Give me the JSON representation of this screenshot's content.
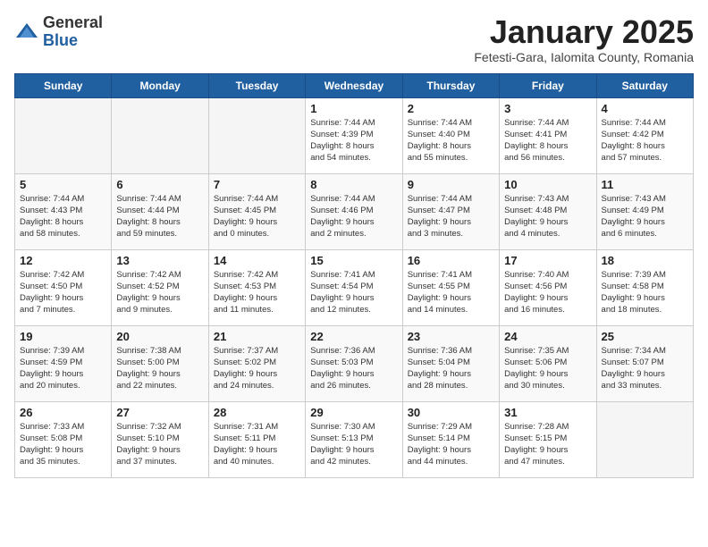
{
  "logo": {
    "general": "General",
    "blue": "Blue"
  },
  "header": {
    "title": "January 2025",
    "subtitle": "Fetesti-Gara, Ialomita County, Romania"
  },
  "weekdays": [
    "Sunday",
    "Monday",
    "Tuesday",
    "Wednesday",
    "Thursday",
    "Friday",
    "Saturday"
  ],
  "weeks": [
    [
      {
        "day": "",
        "info": ""
      },
      {
        "day": "",
        "info": ""
      },
      {
        "day": "",
        "info": ""
      },
      {
        "day": "1",
        "info": "Sunrise: 7:44 AM\nSunset: 4:39 PM\nDaylight: 8 hours\nand 54 minutes."
      },
      {
        "day": "2",
        "info": "Sunrise: 7:44 AM\nSunset: 4:40 PM\nDaylight: 8 hours\nand 55 minutes."
      },
      {
        "day": "3",
        "info": "Sunrise: 7:44 AM\nSunset: 4:41 PM\nDaylight: 8 hours\nand 56 minutes."
      },
      {
        "day": "4",
        "info": "Sunrise: 7:44 AM\nSunset: 4:42 PM\nDaylight: 8 hours\nand 57 minutes."
      }
    ],
    [
      {
        "day": "5",
        "info": "Sunrise: 7:44 AM\nSunset: 4:43 PM\nDaylight: 8 hours\nand 58 minutes."
      },
      {
        "day": "6",
        "info": "Sunrise: 7:44 AM\nSunset: 4:44 PM\nDaylight: 8 hours\nand 59 minutes."
      },
      {
        "day": "7",
        "info": "Sunrise: 7:44 AM\nSunset: 4:45 PM\nDaylight: 9 hours\nand 0 minutes."
      },
      {
        "day": "8",
        "info": "Sunrise: 7:44 AM\nSunset: 4:46 PM\nDaylight: 9 hours\nand 2 minutes."
      },
      {
        "day": "9",
        "info": "Sunrise: 7:44 AM\nSunset: 4:47 PM\nDaylight: 9 hours\nand 3 minutes."
      },
      {
        "day": "10",
        "info": "Sunrise: 7:43 AM\nSunset: 4:48 PM\nDaylight: 9 hours\nand 4 minutes."
      },
      {
        "day": "11",
        "info": "Sunrise: 7:43 AM\nSunset: 4:49 PM\nDaylight: 9 hours\nand 6 minutes."
      }
    ],
    [
      {
        "day": "12",
        "info": "Sunrise: 7:42 AM\nSunset: 4:50 PM\nDaylight: 9 hours\nand 7 minutes."
      },
      {
        "day": "13",
        "info": "Sunrise: 7:42 AM\nSunset: 4:52 PM\nDaylight: 9 hours\nand 9 minutes."
      },
      {
        "day": "14",
        "info": "Sunrise: 7:42 AM\nSunset: 4:53 PM\nDaylight: 9 hours\nand 11 minutes."
      },
      {
        "day": "15",
        "info": "Sunrise: 7:41 AM\nSunset: 4:54 PM\nDaylight: 9 hours\nand 12 minutes."
      },
      {
        "day": "16",
        "info": "Sunrise: 7:41 AM\nSunset: 4:55 PM\nDaylight: 9 hours\nand 14 minutes."
      },
      {
        "day": "17",
        "info": "Sunrise: 7:40 AM\nSunset: 4:56 PM\nDaylight: 9 hours\nand 16 minutes."
      },
      {
        "day": "18",
        "info": "Sunrise: 7:39 AM\nSunset: 4:58 PM\nDaylight: 9 hours\nand 18 minutes."
      }
    ],
    [
      {
        "day": "19",
        "info": "Sunrise: 7:39 AM\nSunset: 4:59 PM\nDaylight: 9 hours\nand 20 minutes."
      },
      {
        "day": "20",
        "info": "Sunrise: 7:38 AM\nSunset: 5:00 PM\nDaylight: 9 hours\nand 22 minutes."
      },
      {
        "day": "21",
        "info": "Sunrise: 7:37 AM\nSunset: 5:02 PM\nDaylight: 9 hours\nand 24 minutes."
      },
      {
        "day": "22",
        "info": "Sunrise: 7:36 AM\nSunset: 5:03 PM\nDaylight: 9 hours\nand 26 minutes."
      },
      {
        "day": "23",
        "info": "Sunrise: 7:36 AM\nSunset: 5:04 PM\nDaylight: 9 hours\nand 28 minutes."
      },
      {
        "day": "24",
        "info": "Sunrise: 7:35 AM\nSunset: 5:06 PM\nDaylight: 9 hours\nand 30 minutes."
      },
      {
        "day": "25",
        "info": "Sunrise: 7:34 AM\nSunset: 5:07 PM\nDaylight: 9 hours\nand 33 minutes."
      }
    ],
    [
      {
        "day": "26",
        "info": "Sunrise: 7:33 AM\nSunset: 5:08 PM\nDaylight: 9 hours\nand 35 minutes."
      },
      {
        "day": "27",
        "info": "Sunrise: 7:32 AM\nSunset: 5:10 PM\nDaylight: 9 hours\nand 37 minutes."
      },
      {
        "day": "28",
        "info": "Sunrise: 7:31 AM\nSunset: 5:11 PM\nDaylight: 9 hours\nand 40 minutes."
      },
      {
        "day": "29",
        "info": "Sunrise: 7:30 AM\nSunset: 5:13 PM\nDaylight: 9 hours\nand 42 minutes."
      },
      {
        "day": "30",
        "info": "Sunrise: 7:29 AM\nSunset: 5:14 PM\nDaylight: 9 hours\nand 44 minutes."
      },
      {
        "day": "31",
        "info": "Sunrise: 7:28 AM\nSunset: 5:15 PM\nDaylight: 9 hours\nand 47 minutes."
      },
      {
        "day": "",
        "info": ""
      }
    ]
  ]
}
